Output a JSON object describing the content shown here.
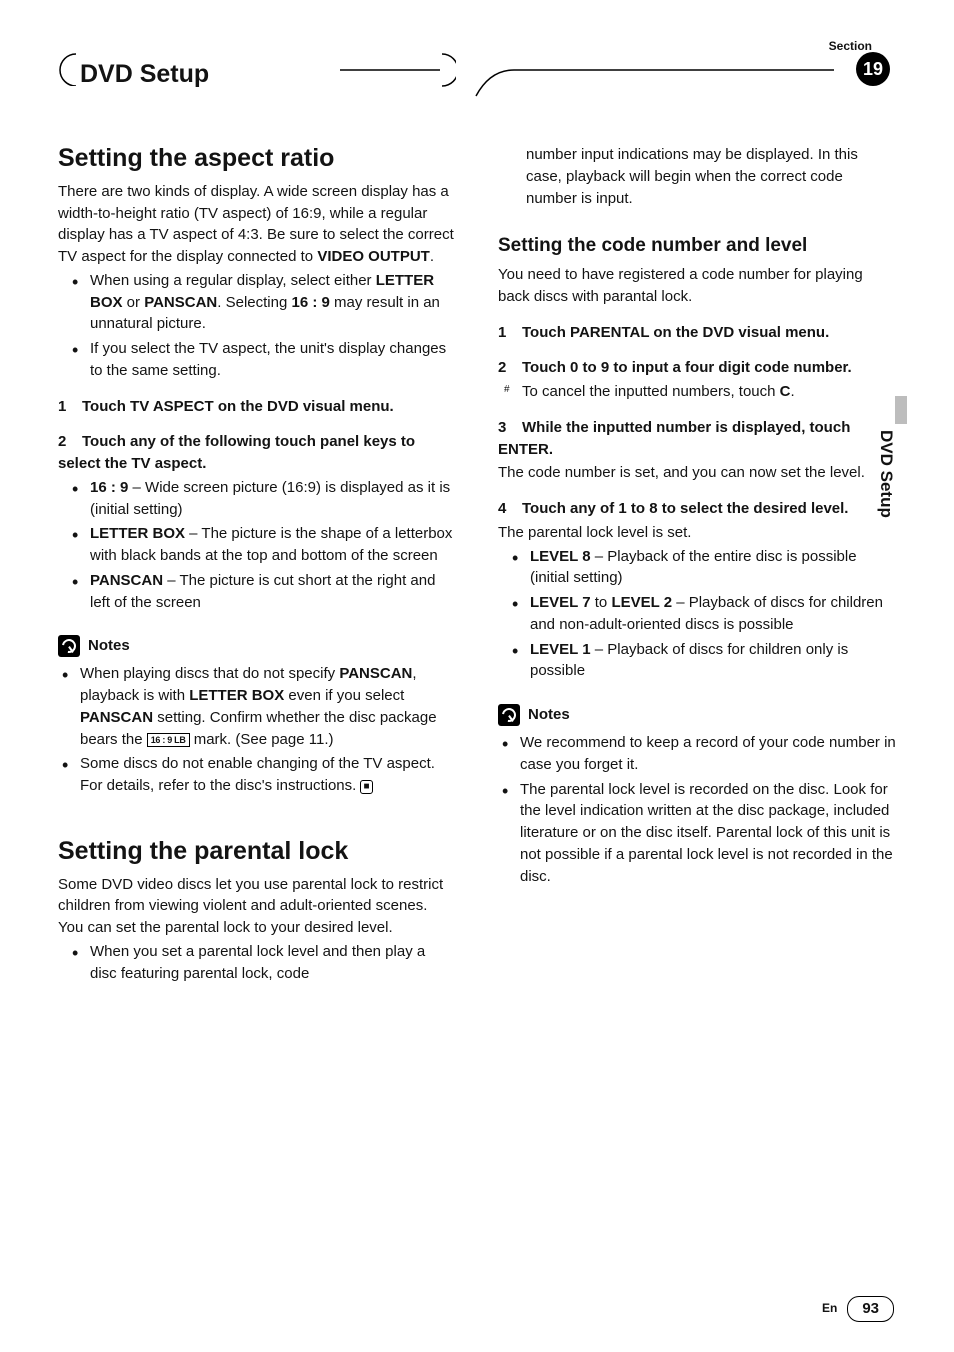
{
  "header": {
    "chapter_title": "DVD Setup",
    "section_label": "Section",
    "section_number": "19",
    "side_tab": "DVD Setup"
  },
  "col1": {
    "h2_aspect": "Setting the aspect ratio",
    "aspect_intro": "There are two kinds of display. A wide screen display has a width-to-height ratio (TV aspect) of 16:9, while a regular display has a TV aspect of 4:3. Be sure to select the correct TV aspect for the display connected to ",
    "video_output": "VIDEO OUTPUT",
    "aspect_intro_end": ".",
    "bullets_a": [
      {
        "pre": "When using a regular display, select either ",
        "b1": "LETTER BOX",
        "mid1": " or ",
        "b2": "PANSCAN",
        "mid2": ". Selecting ",
        "b3": "16 : 9",
        "tail": " may result in an unnatural picture."
      },
      {
        "text": "If you select the TV aspect, the unit's display changes to the same setting."
      }
    ],
    "step1": {
      "num": "1",
      "text": "Touch TV ASPECT on the DVD visual menu."
    },
    "step2": {
      "num": "2",
      "text": "Touch any of the following touch panel keys to select the TV aspect."
    },
    "aspect_options": [
      {
        "b": "16 : 9",
        "t": " – Wide screen picture (16:9) is displayed as it is (initial setting)"
      },
      {
        "b": "LETTER BOX",
        "t": " – The picture is the shape of a letterbox with black bands at the top and bottom of the screen"
      },
      {
        "b": "PANSCAN",
        "t": " – The picture is cut short at the right and left of the screen"
      }
    ],
    "notes_label": "Notes",
    "notes_a": [
      {
        "pre": "When playing discs that do not specify ",
        "b1": "PANSCAN",
        "mid1": ", playback is with ",
        "b2": "LETTER BOX",
        "mid2": " even if you select ",
        "b3": "PANSCAN",
        "mid3": " setting. Confirm whether the disc package bears the ",
        "box": "16 : 9  LB",
        "tail": " mark. (See page 11.)"
      },
      {
        "text": "Some discs do not enable changing of the TV aspect. For details, refer to the disc's instructions.",
        "end": true
      }
    ],
    "h2_parental": "Setting the parental lock",
    "parental_intro": "Some DVD video discs let you use parental lock to restrict children from viewing violent and adult-oriented scenes. You can set the parental lock to your desired level.",
    "parental_bullet": "When you set a parental lock level and then play a disc featuring parental lock, code"
  },
  "col2": {
    "carry_over": "number input indications may be displayed. In this case, playback will begin when the correct code number is input.",
    "h3_code": "Setting the code number and level",
    "code_intro": "You need to have registered a code number for playing back discs with parantal lock.",
    "step1": {
      "num": "1",
      "text": "Touch PARENTAL on the DVD visual menu."
    },
    "step2": {
      "num": "2",
      "text": "Touch 0 to 9 to input a four digit code number."
    },
    "sq_item_pre": "To cancel the inputted numbers, touch ",
    "sq_item_b": "C",
    "sq_item_tail": ".",
    "step3": {
      "num": "3",
      "text": "While the inputted number is displayed, touch ENTER."
    },
    "step3_body": "The code number is set, and you can now set the level.",
    "step4": {
      "num": "4",
      "text": "Touch any of 1 to 8 to select the desired level."
    },
    "step4_body": "The parental lock level is set.",
    "levels": [
      {
        "b": "LEVEL 8",
        "t": " – Playback of the entire disc is possible (initial setting)"
      },
      {
        "b1": "LEVEL 7",
        "mid": " to ",
        "b2": "LEVEL 2",
        "t": " – Playback of discs for children and non-adult-oriented discs is possible"
      },
      {
        "b": "LEVEL 1",
        "t": " – Playback of discs for children only is possible"
      }
    ],
    "notes_label": "Notes",
    "notes": [
      "We recommend to keep a record of your code number in case you forget it.",
      "The parental lock level is recorded on the disc. Look for the level indication written at the disc package, included literature or on the disc itself. Parental lock of this unit is not possible if a parental lock level is not recorded in the disc."
    ]
  },
  "footer": {
    "lang": "En",
    "page": "93"
  }
}
